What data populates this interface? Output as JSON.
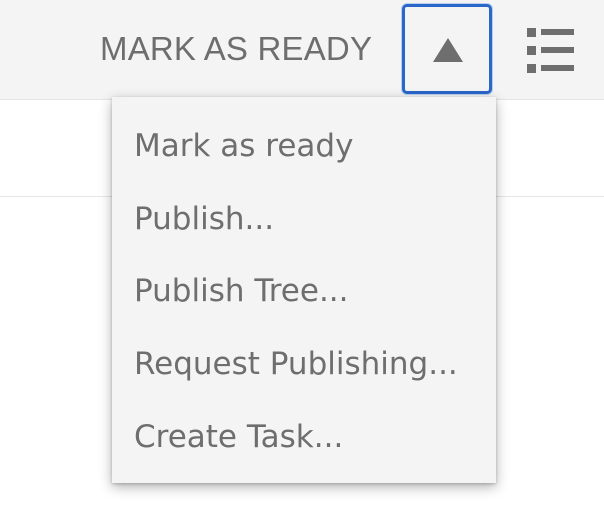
{
  "toolbar": {
    "mark_label": "MARK AS READY",
    "toggle_icon": "triangle-up-icon",
    "list_icon": "list-view-icon"
  },
  "menu": {
    "items": [
      {
        "label": "Mark as ready"
      },
      {
        "label": "Publish..."
      },
      {
        "label": "Publish Tree..."
      },
      {
        "label": "Request Publishing..."
      },
      {
        "label": "Create Task..."
      }
    ]
  },
  "colors": {
    "text": "#6e6e6e",
    "toolbar_bg": "#f4f4f4",
    "focus_border": "#2a67c9"
  }
}
